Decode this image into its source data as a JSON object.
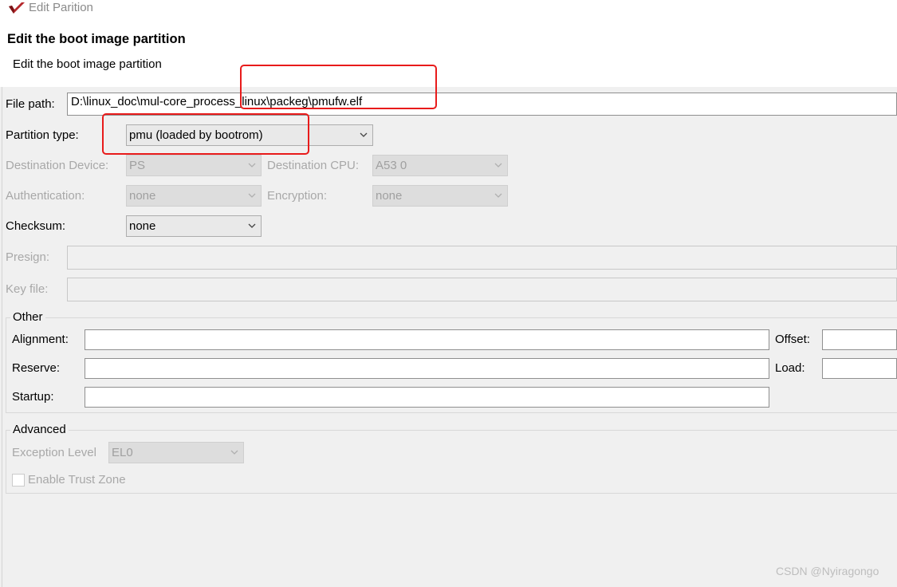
{
  "window": {
    "title": "Edit Parition",
    "icon": "app-logo-icon",
    "brand_color": "#b5282c"
  },
  "dialog": {
    "title": "Edit the boot image partition",
    "subtitle": "Edit the boot image partition"
  },
  "form": {
    "file_path": {
      "label": "File path:",
      "value": "D:\\linux_doc\\mul-core_process_linux\\packeg\\pmufw.elf"
    },
    "partition_type": {
      "label": "Partition type:",
      "value": "pmu (loaded by bootrom)"
    },
    "destination_device": {
      "label": "Destination Device:",
      "value": "PS"
    },
    "destination_cpu": {
      "label": "Destination CPU:",
      "value": "A53 0"
    },
    "authentication": {
      "label": "Authentication:",
      "value": "none"
    },
    "encryption": {
      "label": "Encryption:",
      "value": "none"
    },
    "checksum": {
      "label": "Checksum:",
      "value": "none"
    },
    "presign": {
      "label": "Presign:",
      "value": ""
    },
    "key_file": {
      "label": "Key file:",
      "value": ""
    }
  },
  "other": {
    "title": "Other",
    "alignment": {
      "label": "Alignment:",
      "value": ""
    },
    "offset": {
      "label": "Offset:",
      "value": ""
    },
    "reserve": {
      "label": "Reserve:",
      "value": ""
    },
    "load": {
      "label": "Load:",
      "value": ""
    },
    "startup": {
      "label": "Startup:",
      "value": ""
    }
  },
  "advanced": {
    "title": "Advanced",
    "exception_level": {
      "label": "Exception Level",
      "value": "EL0"
    },
    "trust_zone": {
      "label": "Enable Trust Zone",
      "checked": false
    }
  },
  "annotation_color": "#e81b1b",
  "watermark": "CSDN @Nyiragongo"
}
